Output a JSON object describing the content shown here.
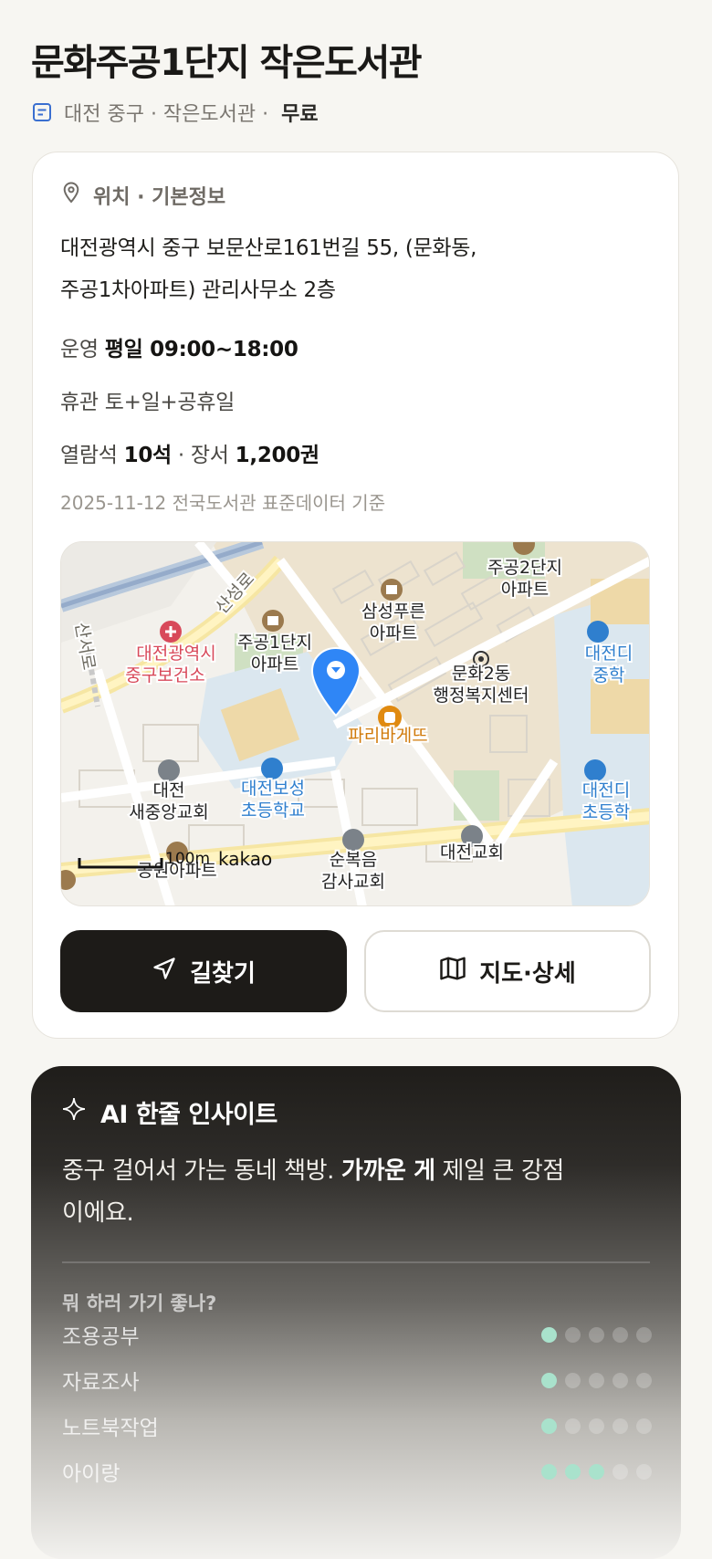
{
  "header": {
    "title": "문화주공1단지 작은도서관",
    "meta": "대전 중구 · 작은도서관 ·",
    "fee": "무료",
    "meta_icon": "document-icon"
  },
  "info": {
    "section_title": "위치 · 기본정보",
    "section_icon": "location-pin-icon",
    "address_line1": "대전광역시 중구 보문산로161번길 55, (문화동,",
    "address_line2": "주공1차아파트) 관리사무소 2층",
    "hours_label": "운영",
    "hours_value": "평일 09:00~18:00",
    "closed_text": "휴관 토+일+공휴일",
    "seats_label": "열람석",
    "seats_value": "10석",
    "books_label": "· 장서",
    "books_value": "1,200권",
    "source": "2025-11-12 전국도서관 표준데이터 기준"
  },
  "map": {
    "labels": {
      "road": "산성로",
      "road2": "산서로",
      "health_center_1": "대전광역시",
      "health_center_2": "중구보건소",
      "apt1_1": "주공1단지",
      "apt1_2": "아파트",
      "samsung_1": "삼성푸른",
      "samsung_2": "아파트",
      "apt2_1": "주공2단지",
      "apt2_2": "아파트",
      "center_1": "문화2동",
      "center_2": "행정복지센터",
      "bakery": "파리바게뜨",
      "church1_1": "대전",
      "church1_2": "새중앙교회",
      "school_1": "대전보성",
      "school_2": "초등학교",
      "school2_1": "대전디",
      "school2_2": "중학",
      "school3_1": "대전디",
      "school3_2": "초등학",
      "church2_1": "순복음",
      "church2_2": "감사교회",
      "church3": "대전교회",
      "park_apt": "공원아파트",
      "scale": "100m",
      "brand": "kakao"
    },
    "colors": {
      "pin": "#2f86f6",
      "health": "#d8495a",
      "school": "#2f7fce",
      "bakery": "#e08a10"
    }
  },
  "buttons": {
    "directions": "길찾기",
    "directions_icon": "navigation-arrow-icon",
    "map_detail": "지도·상세",
    "map_icon": "map-icon"
  },
  "ai": {
    "title": "AI 한줄 인사이트",
    "icon": "sparkle-icon",
    "text_before": "중구 걸어서 가는 동네 책방.",
    "text_bold": "가까운 게",
    "text_after": "제일 큰 강점이에요.",
    "question": "뭐 하러 가기 좋나?",
    "scores": [
      {
        "label": "조용공부",
        "score": 1,
        "max": 5
      },
      {
        "label": "자료조사",
        "score": 1,
        "max": 5
      },
      {
        "label": "노트북작업",
        "score": 1,
        "max": 5
      },
      {
        "label": "아이랑",
        "score": 3,
        "max": 5
      }
    ]
  }
}
